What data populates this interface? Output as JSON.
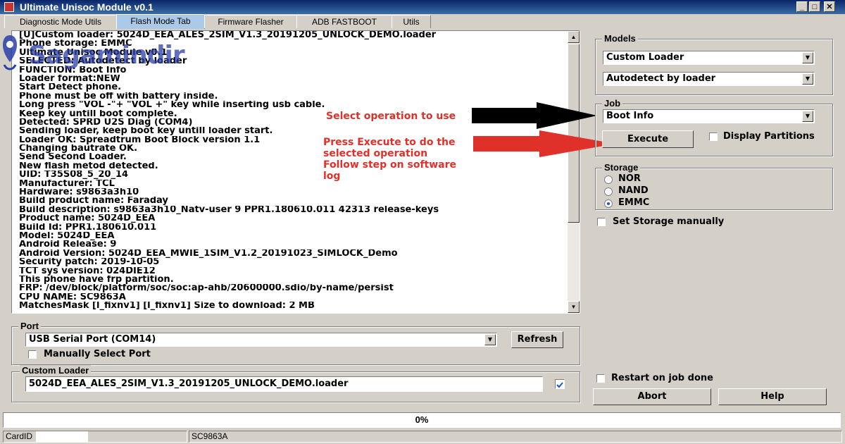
{
  "window": {
    "title": "Ultimate Unisoc Module v0.1",
    "minimize": "_",
    "maximize": "□",
    "close": "✕"
  },
  "tabs": [
    {
      "label": "Diagnostic  Mode Utils"
    },
    {
      "label": "Flash Mode Tab"
    },
    {
      "label": "Firmware Flasher"
    },
    {
      "label": "ADB FASTBOOT"
    },
    {
      "label": "Utils"
    }
  ],
  "watermark": "Sagamindir",
  "log": [
    "[U]Custom loader: 5024D_EEA_ALES_2SIM_V1.3_20191205_UNLOCK_DEMO.loader",
    "Phone storage: EMMC",
    "Ultimate Unisoc Module v0.1",
    "SELECTED: Autodetect by loader",
    "FUNCTION: Boot Info",
    "Loader format:NEW",
    "Start Detect phone.",
    "Phone must be off with battery inside.",
    "Long press \"VOL -\"+ \"VOL +\" key while inserting usb cable.",
    "Keep key untill boot complete.",
    "Detected: SPRD U2S Diag (COM4)",
    "Sending loader, keep boot key untill loader start.",
    "Loader OK: Spreadtrum Boot Block version 1.1",
    "Changing bautrate OK.",
    "Send Second Loader.",
    "New flash metod detected.",
    "UID: T35S08_5_20_14",
    "Manufacturer: TCL",
    "Hardware: s9863a3h10",
    "Build product name: Faraday",
    "Build description: s9863a3h10_Natv-user 9 PPR1.180610.011 42313 release-keys",
    "Product name: 5024D_EEA",
    "Build Id: PPR1.180610.011",
    "Model: 5024D_EEA",
    "Android Release: 9",
    "Android Version: 5024D_EEA_MWIE_1SIM_V1.2_20191023_SIMLOCK_Demo",
    "Security patch: 2019-10-05",
    "TCT sys version: 024DIE12",
    "This phone have frp partition.",
    "FRP: /dev/block/platform/soc/soc:ap-ahb/20600000.sdio/by-name/persist",
    "CPU NAME: SC9863A",
    "MatchesMask [l_fixnv1] [l_fixnv1] Size to download: 2 MB"
  ],
  "annotations": {
    "select_op": "Select operation to use",
    "execute_lines": [
      "Press Execute to do the",
      "selected operation",
      "Follow step on software",
      "log"
    ]
  },
  "arrow_colors": {
    "black": "#000000",
    "red": "#e0302a"
  },
  "models": {
    "legend": "Models",
    "model": "Custom Loader",
    "variant": "Autodetect by loader"
  },
  "job": {
    "legend": "Job",
    "selected": "Boot Info",
    "execute_label": "Execute",
    "display_partitions": "Display Partitions",
    "display_partitions_checked": false
  },
  "storage": {
    "legend": "Storage",
    "options": [
      "NOR",
      "NAND",
      "EMMC"
    ],
    "selected": "EMMC",
    "set_manually": "Set Storage manually",
    "set_manually_checked": false
  },
  "port": {
    "legend": "Port",
    "selected": "USB Serial Port (COM14)",
    "refresh_label": "Refresh",
    "manual": "Manually Select Port",
    "manual_checked": false
  },
  "custom_loader": {
    "legend": "Custom Loader",
    "path": "5024D_EEA_ALES_2SIM_V1.3_20191205_UNLOCK_DEMO.loader",
    "enabled": true
  },
  "actions": {
    "restart_on_done": "Restart on job done",
    "restart_checked": false,
    "abort_label": "Abort",
    "help_label": "Help"
  },
  "progress": {
    "text": "0%",
    "value": 0
  },
  "status": {
    "card_label": "CardID",
    "chip": "SC9863A"
  }
}
